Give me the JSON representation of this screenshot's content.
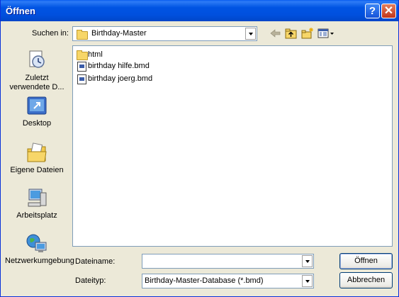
{
  "window": {
    "title": "Öffnen",
    "help_glyph": "?",
    "close_glyph": "✕"
  },
  "lookin": {
    "label": "Suchen in:",
    "value": "Birthday-Master"
  },
  "toolbar": {
    "icons": [
      "back-arrow-icon",
      "up-folder-icon",
      "new-folder-icon",
      "view-menu-icon"
    ]
  },
  "files": [
    {
      "name": "html",
      "type": "folder"
    },
    {
      "name": "birthday hilfe.bmd",
      "type": "file"
    },
    {
      "name": "birthday joerg.bmd",
      "type": "file"
    }
  ],
  "places": [
    {
      "label": "Zuletzt verwendete D...",
      "icon": "recent-documents-icon"
    },
    {
      "label": "Desktop",
      "icon": "desktop-icon"
    },
    {
      "label": "Eigene Dateien",
      "icon": "my-documents-icon"
    },
    {
      "label": "Arbeitsplatz",
      "icon": "my-computer-icon"
    },
    {
      "label": "Netzwerkumgebung",
      "icon": "network-places-icon"
    }
  ],
  "filename": {
    "label": "Dateiname:",
    "value": ""
  },
  "filetype": {
    "label": "Dateityp:",
    "value": "Birthday-Master-Database (*.bmd)"
  },
  "buttons": {
    "open": "Öffnen",
    "cancel": "Abbrechen"
  },
  "colors": {
    "titlebar": "#0054E3",
    "dialog": "#ECE9D8",
    "close": "#C2351A",
    "field_border": "#7F9DB9"
  }
}
